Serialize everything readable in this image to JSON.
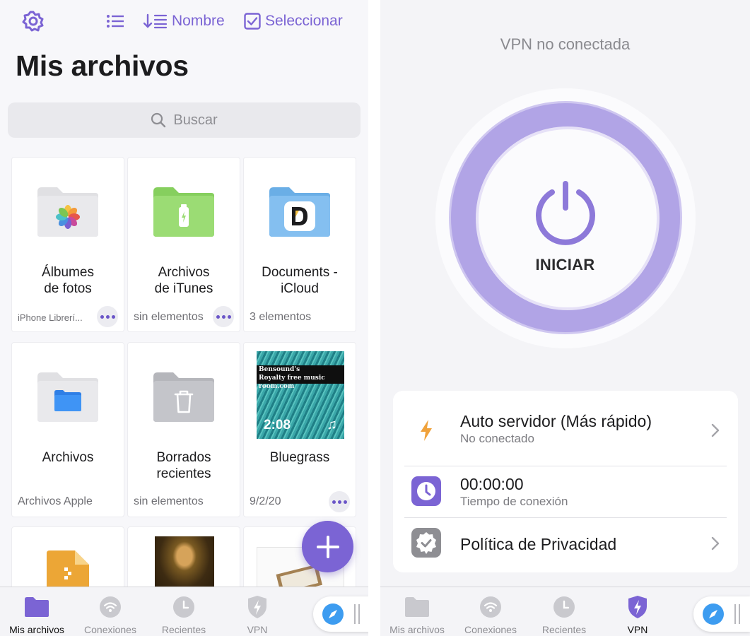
{
  "colors": {
    "accent": "#7b64d4",
    "ring": "#b1a4e6",
    "bolt": "#f0a23b"
  },
  "left": {
    "toolbar": {
      "sort_label": "Nombre",
      "select_label": "Seleccionar"
    },
    "title": "Mis archivos",
    "search": {
      "placeholder": "Buscar"
    },
    "tiles": [
      {
        "name": "Álbumes\nde fotos",
        "meta": "iPhone Librerí...",
        "icon": "photos-folder-icon"
      },
      {
        "name": "Archivos\nde iTunes",
        "meta": "sin elementos",
        "icon": "itunes-folder-icon"
      },
      {
        "name": "Documents -\niCloud",
        "meta": "3 elementos",
        "icon": "documents-folder-icon"
      },
      {
        "name": "Archivos",
        "meta": "Archivos Apple",
        "icon": "files-folder-icon"
      },
      {
        "name": "Borrados\nrecientes",
        "meta": "sin elementos",
        "icon": "trash-folder-icon"
      },
      {
        "name": "Bluegrass",
        "meta": "9/2/20",
        "icon": "music-thumbnail",
        "duration": "2:08",
        "thumb_text_1": "Bensound's",
        "thumb_text_2": "Royalty free music room.com"
      }
    ],
    "tabs": [
      {
        "label": "Mis archivos",
        "icon": "folder-icon",
        "active": true
      },
      {
        "label": "Conexiones",
        "icon": "wifi-icon"
      },
      {
        "label": "Recientes",
        "icon": "clock-icon"
      },
      {
        "label": "VPN",
        "icon": "shield-bolt-icon"
      }
    ]
  },
  "right": {
    "status": "VPN no conectada",
    "start_label": "INICIAR",
    "rows": [
      {
        "title": "Auto servidor (Más rápido)",
        "subtitle": "No conectado",
        "icon": "bolt-icon"
      },
      {
        "title": "00:00:00",
        "subtitle": "Tiempo de conexión",
        "icon": "clock-icon"
      },
      {
        "title": "Política de Privacidad",
        "icon": "badge-check-icon"
      }
    ],
    "tabs": [
      {
        "label": "Mis archivos",
        "icon": "folder-icon"
      },
      {
        "label": "Conexiones",
        "icon": "wifi-icon"
      },
      {
        "label": "Recientes",
        "icon": "clock-icon"
      },
      {
        "label": "VPN",
        "icon": "shield-bolt-icon",
        "active": true
      }
    ]
  }
}
